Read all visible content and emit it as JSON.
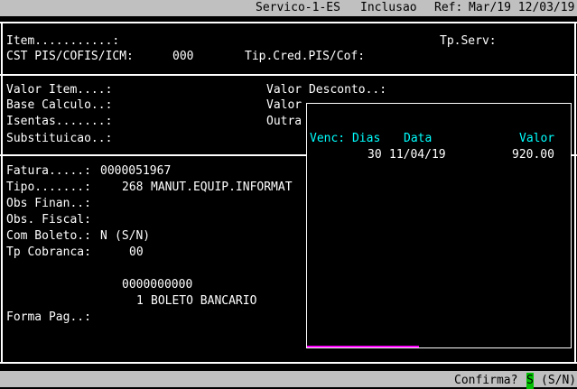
{
  "title_bar": {
    "program": "Servico-1-ES",
    "mode": "Inclusao",
    "ref_label": "Ref:",
    "ref_value": "Mar/19 12/03/19"
  },
  "header_section": {
    "item_label": "Item...........:",
    "tp_serv_label": "Tp.Serv:",
    "cst_label": "CST PIS/COFIS/ICM:",
    "cst_value": "000",
    "tip_cred_label": "Tip.Cred.PIS/Cof:"
  },
  "values_section": {
    "valor_item_label": "Valor Item....:",
    "valor_desconto_label": "Valor Desconto..:",
    "base_calculo_label": "Base Calculo..:",
    "valor_partial": "Valor",
    "isentas_label": "Isentas.......:",
    "outra_partial": "Outra",
    "substituicao_label": "Substituicao..:"
  },
  "invoice_section": {
    "fatura_label": "Fatura.....:",
    "fatura_value": "0000051967",
    "tipo_label": "Tipo.......:",
    "tipo_code": "268",
    "tipo_desc": "MANUT.EQUIP.INFORMAT",
    "obs_finan_label": "Obs Finan..:",
    "obs_fiscal_label": "Obs. Fiscal:",
    "com_boleto_label": "Com Boleto.:",
    "com_boleto_value": "N",
    "com_boleto_hint": "(S/N)",
    "tp_cobranca_label": "Tp Cobranca:",
    "tp_cobranca_value": "00",
    "account_number": "0000000000",
    "cobranca_code": "1",
    "cobranca_desc": "BOLETO BANCARIO",
    "forma_pag_label": "Forma Pag..:"
  },
  "installments_popup": {
    "headers": [
      "Venc: Dias",
      "Data",
      "Valor"
    ],
    "rows": [
      {
        "dias": "30",
        "data": "11/04/19",
        "valor": "920.00"
      }
    ]
  },
  "status_bar": {
    "prompt": "Confirma?",
    "answer": "S",
    "hint": "(S/N)"
  },
  "colors": {
    "background": "#000000",
    "text": "#ffffff",
    "bar": "#c0c0c0",
    "popup_header": "#00ffff",
    "cursor": "#00c000",
    "accent_line": "#ff00ff"
  }
}
